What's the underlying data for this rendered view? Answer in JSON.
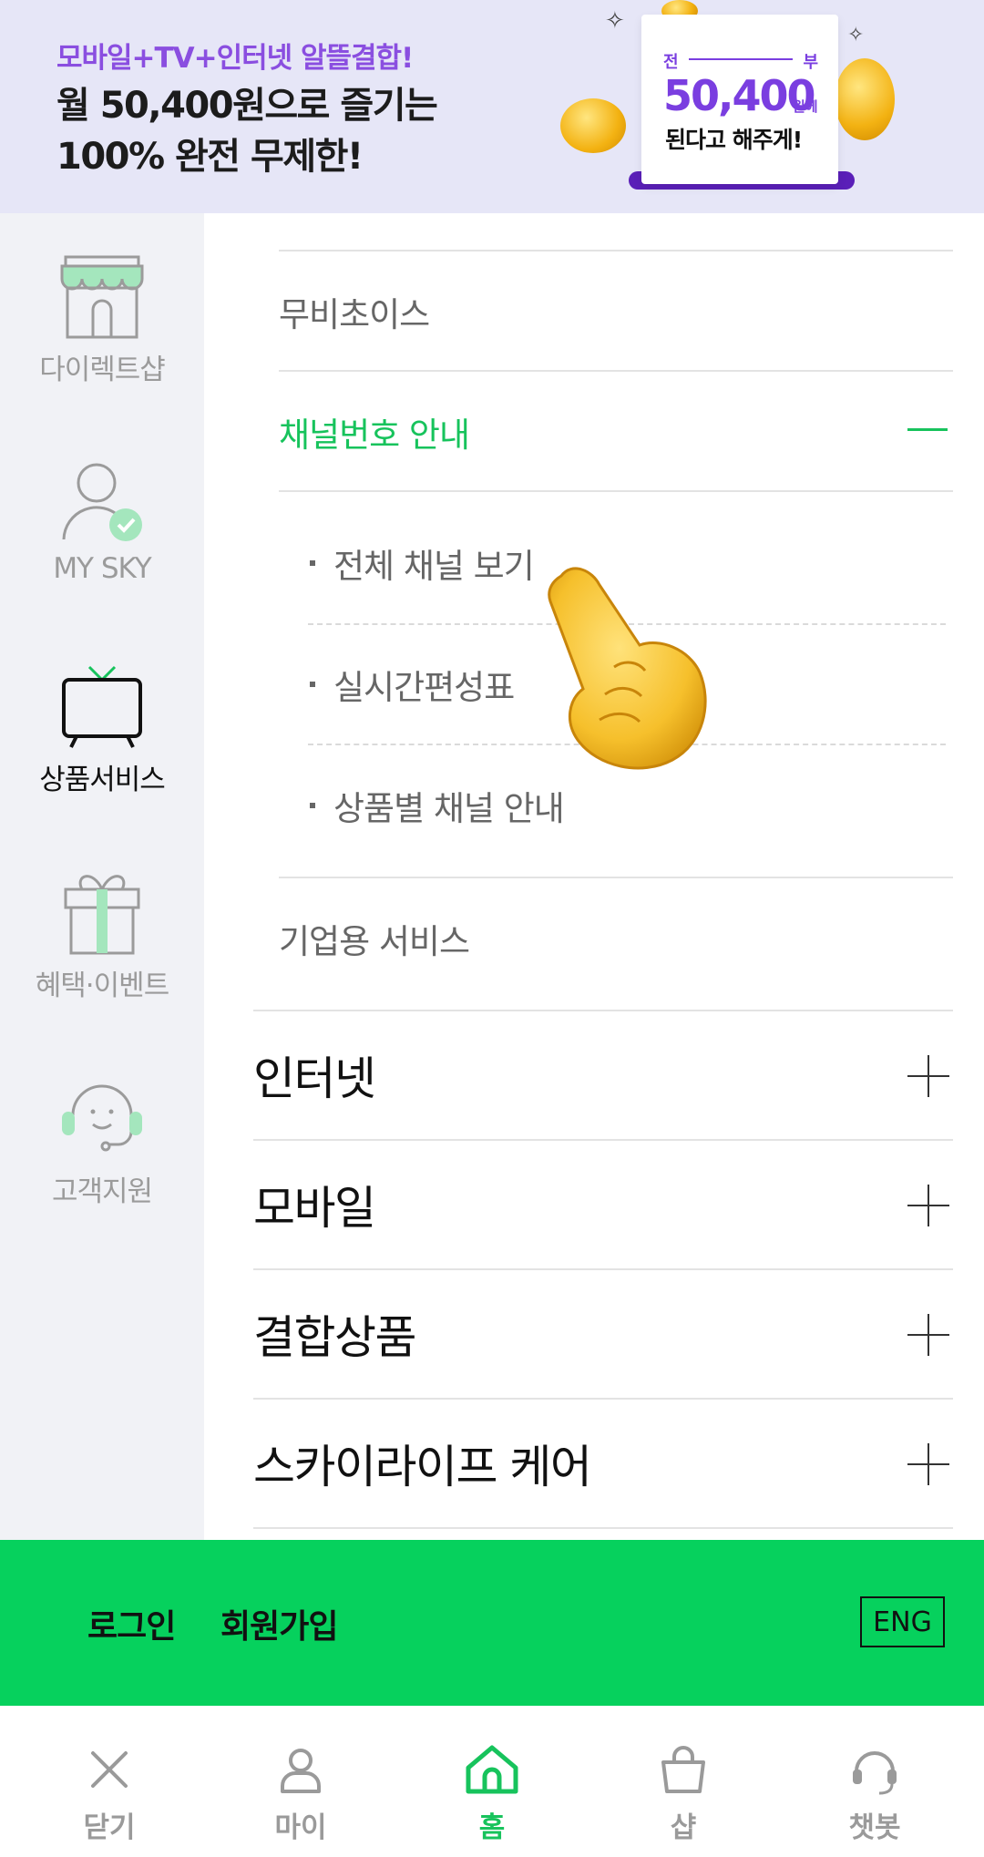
{
  "banner": {
    "subtitle": "모바일+TV+인터넷 알뜰결합!",
    "title_line1": "월 50,400원으로 즐기는",
    "title_line2": "100% 완전 무제한!",
    "receipt_left": "전",
    "receipt_right": "부",
    "receipt_amount": "50,400",
    "receipt_unit": "원에",
    "receipt_caption": "된다고 해주게!"
  },
  "sidebar": {
    "items": [
      {
        "label": "다이렉트샵",
        "icon": "store-icon"
      },
      {
        "label": "MY SKY",
        "icon": "user-check-icon"
      },
      {
        "label": "상품서비스",
        "icon": "tv-icon",
        "active": true
      },
      {
        "label": "혜택·이벤트",
        "icon": "gift-icon"
      },
      {
        "label": "고객지원",
        "icon": "headset-icon"
      }
    ]
  },
  "menu": {
    "sub_movie": "무비초이스",
    "sub_channel": "채널번호 안내",
    "channel_items": [
      "전체 채널 보기",
      "실시간편성표",
      "상품별 채널 안내"
    ],
    "sub_business": "기업용 서비스",
    "categories": [
      "인터넷",
      "모바일",
      "결합상품",
      "스카이라이프 케어"
    ]
  },
  "account": {
    "login": "로그인",
    "signup": "회원가입",
    "language": "ENG"
  },
  "bottom_nav": {
    "items": [
      {
        "label": "닫기",
        "icon": "close-icon"
      },
      {
        "label": "마이",
        "icon": "person-icon"
      },
      {
        "label": "홈",
        "icon": "home-icon",
        "active": true
      },
      {
        "label": "샵",
        "icon": "shopping-bag-icon"
      },
      {
        "label": "챗봇",
        "icon": "headset-icon"
      }
    ]
  },
  "colors": {
    "accent_green": "#17c35c",
    "bar_green": "#06d15d",
    "banner_purple": "#8a4ee0",
    "banner_bg": "#e6e6f7"
  }
}
